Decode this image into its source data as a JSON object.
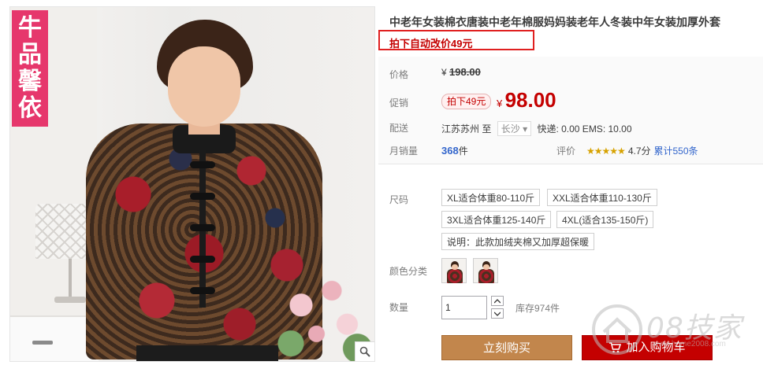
{
  "gallery": {
    "brand_badge": [
      "牛",
      "品",
      "馨",
      "依"
    ],
    "zoom_icon": "magnifier-icon"
  },
  "product": {
    "title": "中老年女装棉衣唐装中老年棉服妈妈装老年人冬装中年女装加厚外套",
    "promo_notice": "拍下自动改价49元"
  },
  "price": {
    "label": "价格",
    "currency": "¥",
    "original": "198.00"
  },
  "promotion": {
    "label": "促销",
    "tag": "拍下49元",
    "currency": "¥",
    "price": "98.00"
  },
  "shipping": {
    "label": "配送",
    "from": "江苏苏州",
    "to_word": "至",
    "destination": "长沙",
    "fees": "快递: 0.00 EMS: 10.00"
  },
  "sales": {
    "label": "月销量",
    "count": "368",
    "unit": "件"
  },
  "rating": {
    "label": "评价",
    "stars": "★★★★★",
    "score": "4.7分",
    "reviews": "累计550条"
  },
  "sizes": {
    "label": "尺码",
    "options": [
      "XL适合体重80-110斤",
      "XXL适合体重110-130斤",
      "3XL适合体重125-140斤",
      "4XL(适合135-150斤)",
      "说明：此款加绒夹棉又加厚超保暖"
    ]
  },
  "colors": {
    "label": "颜色分类",
    "option_count": 2
  },
  "quantity": {
    "label": "数量",
    "value": "1",
    "stock": "库存974件"
  },
  "actions": {
    "buy_now": "立刻购买",
    "add_to_cart": "加入购物车"
  },
  "watermark": {
    "text": "08技家",
    "url": "www.home2008.com"
  },
  "colors_theme": {
    "price_red": "#c40000",
    "promo_border": "#e02020",
    "buy_now_bg": "#c2864c",
    "add_cart_bg": "#c40000",
    "brand_pink": "#e6376c",
    "link_blue": "#3366cc"
  }
}
